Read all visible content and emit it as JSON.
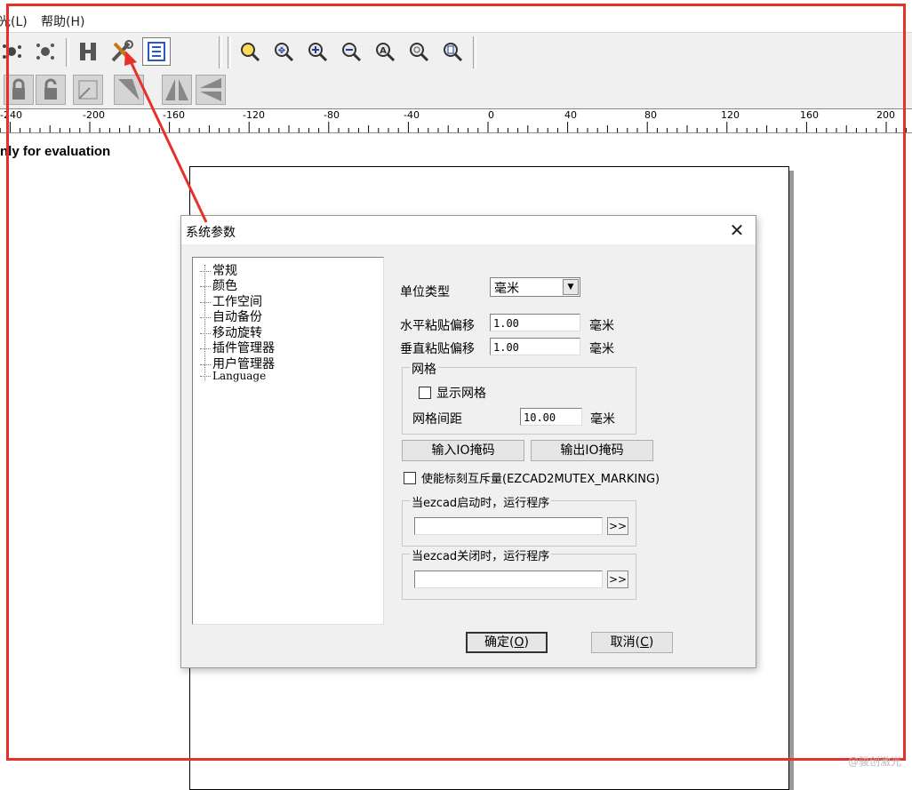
{
  "menu": {
    "items": [
      "光(L)",
      "帮助(H)"
    ]
  },
  "ruler": {
    "ticks": [
      "-240",
      "-200",
      "-160",
      "-120",
      "-80",
      "-40",
      "0",
      "40",
      "80",
      "120",
      "160",
      "200"
    ]
  },
  "canvas": {
    "eval_note": "nly for evaluation"
  },
  "dialog": {
    "title": "系统参数",
    "close_glyph": "✕",
    "tree_items": [
      "常规",
      "颜色",
      "工作空间",
      "自动备份",
      "移动旋转",
      "插件管理器",
      "用户管理器",
      "Language"
    ],
    "unit_type": {
      "label": "单位类型",
      "value": "毫米"
    },
    "h_offset": {
      "label": "水平粘贴偏移",
      "value": "1.00",
      "unit": "毫米"
    },
    "v_offset": {
      "label": "垂直粘贴偏移",
      "value": "1.00",
      "unit": "毫米"
    },
    "grid": {
      "title": "网格",
      "show_label": "显示网格",
      "spacing_label": "网格间距",
      "spacing_value": "10.00",
      "unit": "毫米"
    },
    "io_in_button": "输入IO掩码",
    "io_out_button": "输出IO掩码",
    "mutex_label": "使能标刻互斥量(EZCAD2MUTEX_MARKING)",
    "on_start": {
      "title": "当ezcad启动时，运行程序",
      "value": "",
      "browse": ">>"
    },
    "on_close": {
      "title": "当ezcad关闭时，运行程序",
      "value": "",
      "browse": ">>"
    },
    "ok_button": {
      "text": "确定(",
      "key": "O",
      "end": ")"
    },
    "cancel_button": {
      "text": "取消(",
      "key": "C",
      "end": ")"
    }
  },
  "colors": {
    "annotation": "#e8302a",
    "dialog_bg": "#f0f0f0",
    "toolbar_bg": "#f0f0f0"
  },
  "icons": [
    "hatch-icon",
    "parameters-icon",
    "object-list-icon",
    "zoom-icon",
    "zoom-in-icon",
    "zoom-out-icon"
  ],
  "watermark": "@骏创激光"
}
